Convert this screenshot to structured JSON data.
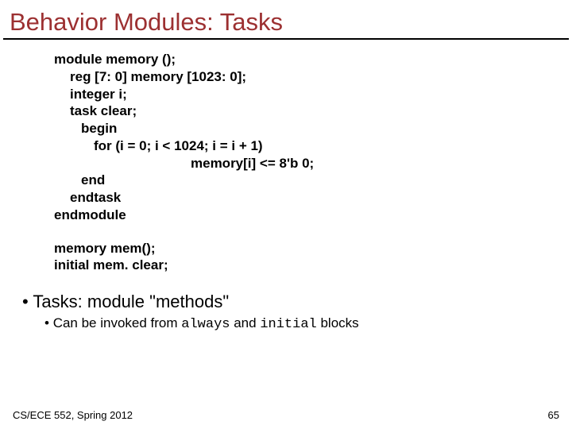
{
  "title": "Behavior Modules: Tasks",
  "code": {
    "module_decl": "module memory ();",
    "reg_decl": "reg [7: 0] memory [1023: 0];",
    "int_decl": "integer i;",
    "task_decl": "task clear;",
    "begin_kw": "begin",
    "for_stmt": "for (i = 0; i < 1024; i = i + 1)",
    "assign_stmt": "memory[i] <= 8'b 0;",
    "end_kw": "end",
    "endtask_kw": "endtask",
    "endmodule_kw": "endmodule"
  },
  "invoke": {
    "inst": "memory mem();",
    "call": "initial mem. clear;"
  },
  "bullets": {
    "b1_text": "Tasks: module \"methods\"",
    "b2_prefix": "Can be invoked from ",
    "b2_kw1": "always",
    "b2_mid": " and ",
    "b2_kw2": "initial",
    "b2_suffix": " blocks"
  },
  "footer": {
    "left": "CS/ECE 552, Spring 2012",
    "right": "65"
  }
}
